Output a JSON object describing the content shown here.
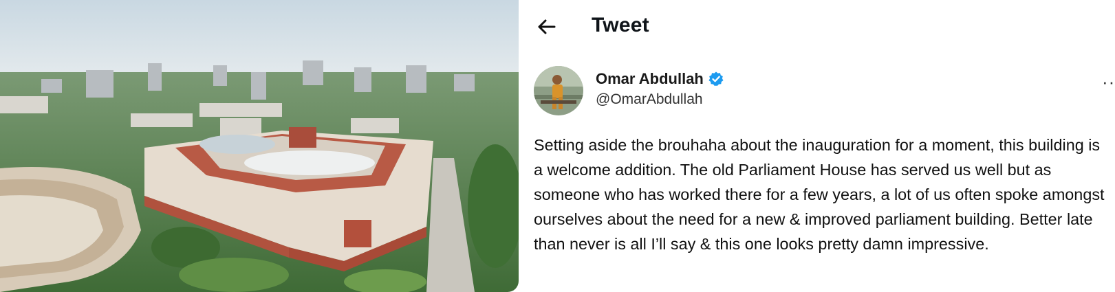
{
  "header": {
    "title": "Tweet",
    "back_icon": "arrow-left-icon"
  },
  "author": {
    "display_name": "Omar Abdullah",
    "handle": "@OmarAbdullah",
    "verified": true,
    "verified_color": "#1d9bf0",
    "more_label": "···"
  },
  "tweet": {
    "text": "Setting aside the brouhaha about the inauguration for a moment, this building is a welcome addition. The old Parliament House has served us well but as someone who has worked there for a few years, a lot of us often spoke amongst ourselves about the need for a new & improved parliament building. Better late than never is all I’ll say & this one looks pretty damn impressive."
  },
  "colors": {
    "text": "#0f1419",
    "accent": "#1d9bf0"
  }
}
